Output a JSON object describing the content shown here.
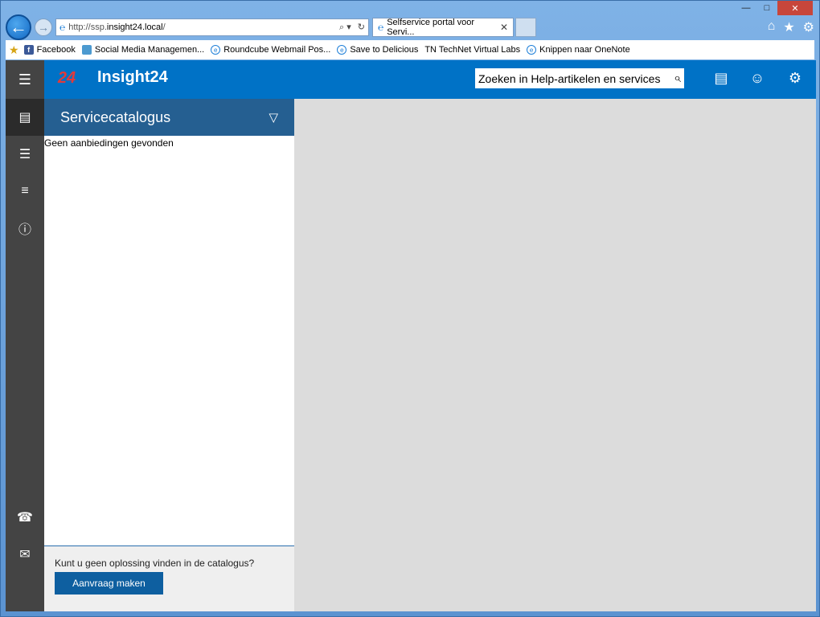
{
  "browser": {
    "address": {
      "prefix": "http://ssp.",
      "host": "insight24.local",
      "suffix": "/"
    },
    "tab_title": "Selfservice portal voor Servi...",
    "favorites": [
      {
        "label": "Facebook",
        "icon": "facebook-icon"
      },
      {
        "label": "Social Media Managemen...",
        "icon": "social-icon"
      },
      {
        "label": "Roundcube Webmail  Pos...",
        "icon": "ie-page-icon"
      },
      {
        "label": "Save to Delicious",
        "icon": "ie-page-icon"
      },
      {
        "label": "TN TechNet Virtual Labs",
        "icon": ""
      },
      {
        "label": "Knippen naar OneNote",
        "icon": "ie-page-icon"
      }
    ]
  },
  "header": {
    "brand": "Insight24",
    "logo_text": "24",
    "search_placeholder": "Zoeken in Help-artikelen en services"
  },
  "catalog": {
    "title": "Servicecatalogus",
    "empty_message": "Geen aanbiedingen gevonden",
    "footer_text": "Kunt u geen oplossing vinden in de catalogus?",
    "request_button": "Aanvraag maken"
  },
  "colors": {
    "header_blue": "#0072c6",
    "rail_gray": "#444444",
    "panel_header": "#255f91",
    "button_blue": "#0e5fa0"
  }
}
